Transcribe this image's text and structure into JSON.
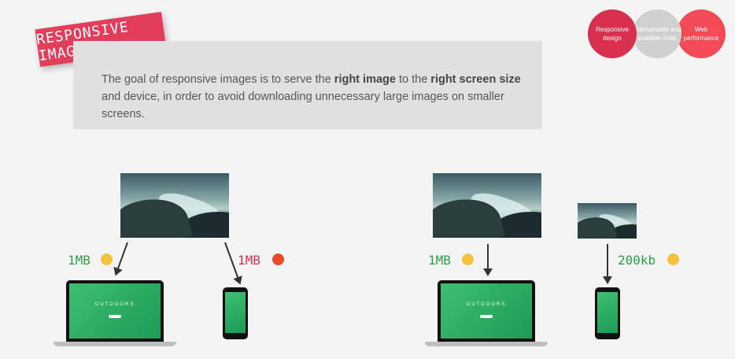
{
  "badge": {
    "title": "RESPONSIVE IMAGES"
  },
  "topics": [
    {
      "label": "Responsive design",
      "color": "#d9304e"
    },
    {
      "label": "Maintainable and scalable code",
      "color": "#d0d0d0"
    },
    {
      "label": "Web performance",
      "color": "#f34b55"
    }
  ],
  "goal": {
    "pre": "The goal of responsive images is to serve the ",
    "b1": "right image",
    "mid": " to the ",
    "b2": "right screen size",
    "post": " and device, in order to avoid downloading unnecessary large images on smaller screens."
  },
  "left": {
    "laptop_size": "1MB",
    "phone_size": "1MB"
  },
  "right": {
    "laptop_size": "1MB",
    "phone_size": "200kb"
  },
  "device_screen_title": "OUTDOORS",
  "colors": {
    "green": "#2e9e4a",
    "red": "#d9304e"
  }
}
